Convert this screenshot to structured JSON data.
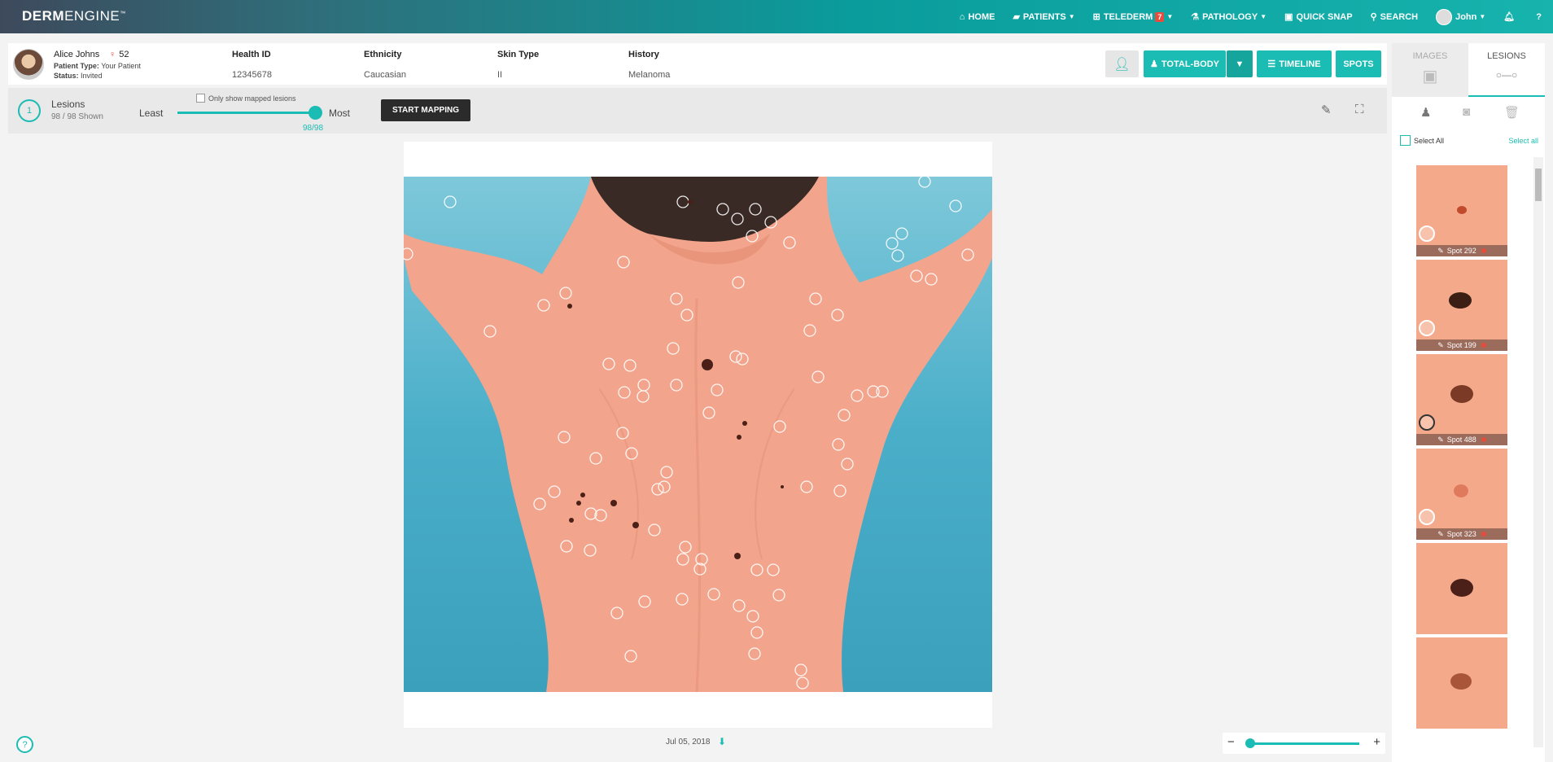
{
  "app": {
    "logo_bold": "DERM",
    "logo_rest": "ENGINE",
    "logo_tm": "™"
  },
  "nav": {
    "home": "HOME",
    "patients": "PATIENTS",
    "telederm": "TELEDERM",
    "telederm_badge": "7",
    "pathology": "PATHOLOGY",
    "quick_snap": "QUICK SNAP",
    "search": "SEARCH",
    "user": "John"
  },
  "patient": {
    "name": "Alice Johns",
    "age": "52",
    "type_label": "Patient Type:",
    "type_value": "Your Patient",
    "status_label": "Status:",
    "status_value": "Invited",
    "health_id_label": "Health ID",
    "health_id": "12345678",
    "ethnicity_label": "Ethnicity",
    "ethnicity": "Caucasian",
    "skin_type_label": "Skin Type",
    "skin_type": "II",
    "history_label": "History",
    "history": "Melanoma"
  },
  "actions": {
    "total_body": "TOTAL-BODY",
    "timeline": "TIMELINE",
    "spots": "SPOTS"
  },
  "lesions": {
    "step": "1",
    "title": "Lesions",
    "shown": "98 / 98 Shown",
    "only_mapped": "Only show mapped lesions",
    "least": "Least",
    "most": "Most",
    "slider_value": "98/98",
    "slider_fraction": 1.0,
    "start_mapping": "START MAPPING"
  },
  "image": {
    "date": "Jul 05, 2018"
  },
  "sidebar": {
    "tab_images": "IMAGES",
    "tab_lesions": "LESIONS",
    "select_all": "Select All",
    "select_all_link": "Select all",
    "spots": [
      {
        "label": "Spot 292"
      },
      {
        "label": "Spot 199"
      },
      {
        "label": "Spot 488"
      },
      {
        "label": "Spot 323"
      },
      {
        "label": ""
      },
      {
        "label": ""
      }
    ]
  },
  "colors": {
    "accent": "#1bbcb3",
    "dark": "#2b2b2b",
    "alert": "#e74c3c"
  }
}
